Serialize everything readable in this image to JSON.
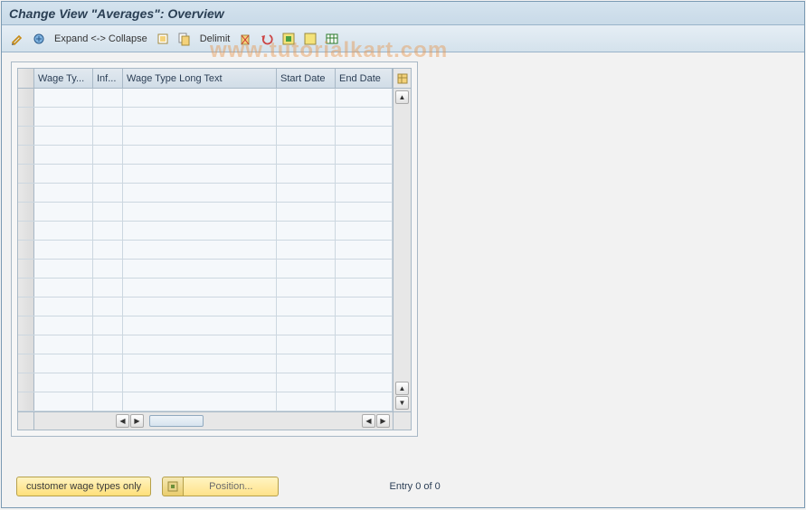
{
  "watermark": "www.tutorialkart.com",
  "title": "Change View \"Averages\": Overview",
  "toolbar": {
    "expand": "Expand <-> Collapse",
    "delimit": "Delimit"
  },
  "table": {
    "columns": {
      "wage_type": "Wage Ty...",
      "infotype": "Inf...",
      "long_text": "Wage Type Long Text",
      "start_date": "Start Date",
      "end_date": "End Date"
    },
    "row_count": 17
  },
  "footer": {
    "customer_btn": "customer wage types only",
    "position_btn": "Position...",
    "entry_text": "Entry 0 of 0"
  }
}
